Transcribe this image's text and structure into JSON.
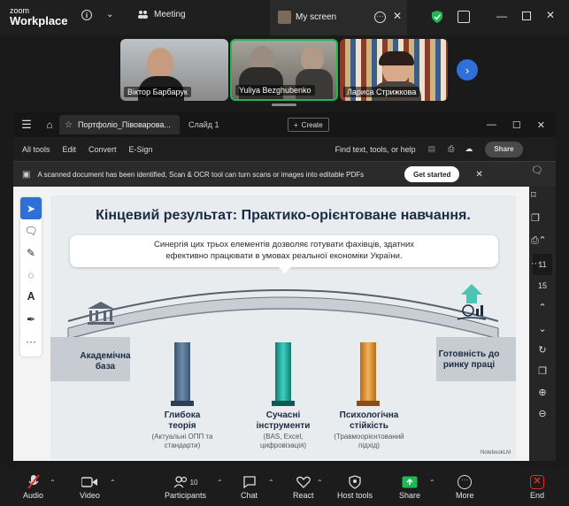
{
  "zoom": {
    "logo_line1": "zoom",
    "logo_line2": "Workplace",
    "meeting_label": "Meeting",
    "my_screen_label": "My screen",
    "participants_count": "10"
  },
  "participants": [
    {
      "name": "Віктор Барбарук"
    },
    {
      "name": "Yuliya Bezghubenko"
    },
    {
      "name": "Лариса Стрижкова"
    }
  ],
  "pdf": {
    "tab_title": "Портфоліо_Півоварова...",
    "tab2": "Слайд 1",
    "create_label": "Create",
    "menu": [
      "All tools",
      "Edit",
      "Convert",
      "E-Sign"
    ],
    "find_label": "Find text, tools, or help",
    "share_label": "Share",
    "banner_text": "A scanned document has been identified, Scan & OCR tool can turn scans or images into editable PDFs",
    "get_started": "Get started",
    "page_current": "11",
    "page_total": "15"
  },
  "slide": {
    "title": "Кінцевий результат: Практико-орієнтоване навчання.",
    "callout": "Синергія цих трьох елементів дозволяє готувати фахівців, здатних ефективно працювати в умовах реальної економіки України.",
    "left_label": "Академічна база",
    "right_label": "Готовність до ринку праці",
    "pillars": [
      {
        "title": "Глибока теорія",
        "sub": "(Актуальні ОПП та стандарти)"
      },
      {
        "title": "Сучасні інструменти",
        "sub": "(BAS, Excel, цифровізація)"
      },
      {
        "title": "Психологічна стійкість",
        "sub": "(Травмоорієнтований підхід)"
      }
    ],
    "watermark": "NotebookLM"
  },
  "toolbar": {
    "audio": "Audio",
    "video": "Video",
    "participants": "Participants",
    "chat": "Chat",
    "react": "React",
    "host_tools": "Host tools",
    "share": "Share",
    "more": "More",
    "end": "End"
  },
  "colors": {
    "zoom_green": "#1db954",
    "end_red": "#e02828",
    "accent_blue": "#2e6fd8"
  }
}
